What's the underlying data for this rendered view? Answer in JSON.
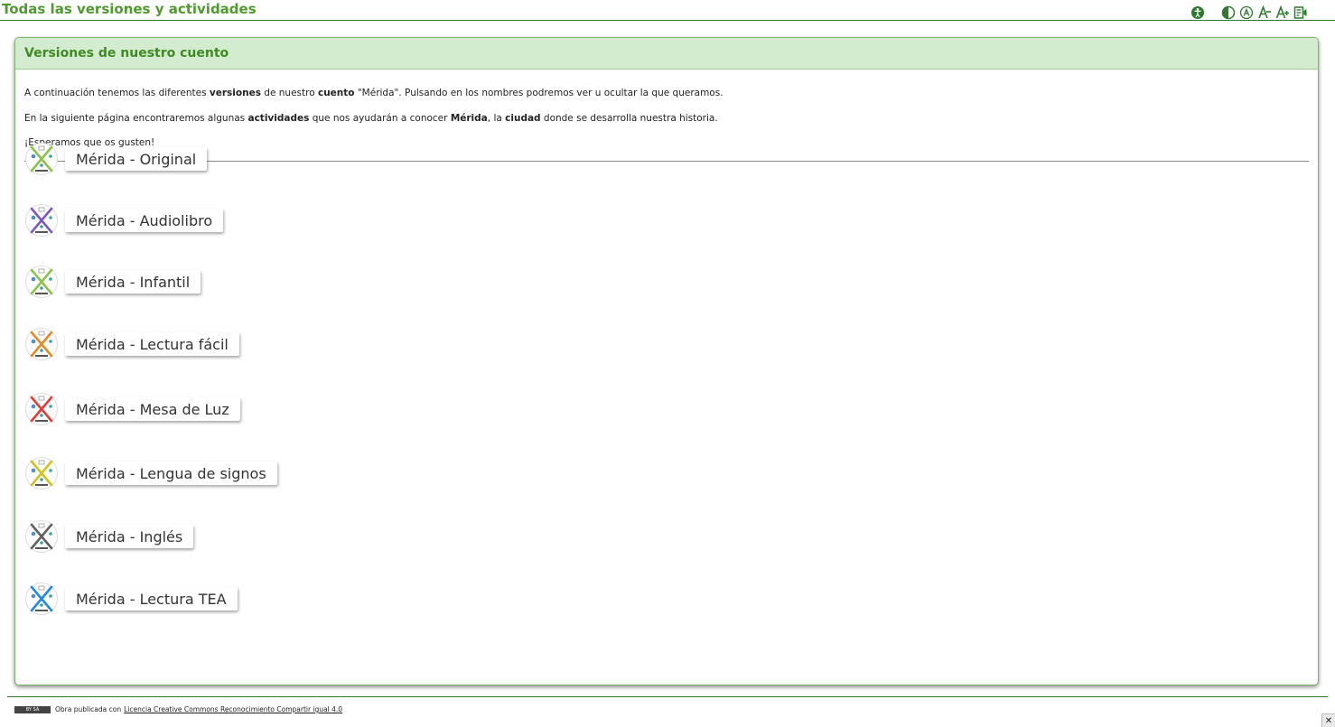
{
  "header": {
    "title": "Todas las versiones y actividades",
    "toolbar": [
      {
        "icon": "accessibility-icon"
      },
      {
        "icon": "contrast-icon"
      },
      {
        "icon": "font-type-icon"
      },
      {
        "icon": "font-decrease-icon"
      },
      {
        "icon": "font-increase-icon"
      },
      {
        "icon": "read-aloud-icon"
      }
    ]
  },
  "panel": {
    "title": "Versiones de nuestro cuento",
    "intro": {
      "p1": [
        "A continuación tenemos las diferentes ",
        "versiones",
        " de nuestro ",
        "cuento",
        " \"Mérida\". Pulsando en los nombres podremos ver u ocultar la que queramos."
      ],
      "p2": [
        "En la siguiente página encontraremos algunas ",
        "actividades",
        " que nos ayudarán a conocer ",
        "Mérida",
        ", la ",
        "ciudad",
        " donde se desarrolla nuestra historia."
      ],
      "p3": "¡Esperamos que os gusten!"
    },
    "versions": [
      {
        "label": "Mérida - Original",
        "color": "#8bc34a"
      },
      {
        "label": "Mérida - Audiolibro",
        "color": "#7e57c2"
      },
      {
        "label": "Mérida - Infantil",
        "color": "#8bc34a"
      },
      {
        "label": "Mérida - Lectura fácil",
        "color": "#e68a1f"
      },
      {
        "label": "Mérida - Mesa de Luz",
        "color": "#e53935"
      },
      {
        "label": "Mérida - Lengua de signos",
        "color": "#d4c21a"
      },
      {
        "label": "Mérida - Inglés",
        "color": "#616161"
      },
      {
        "label": "Mérida - Lectura TEA",
        "color": "#1e88e5"
      }
    ]
  },
  "footer": {
    "badge": "BY SA",
    "text": "Obra publicada con",
    "link": "Licencia Creative Commons Reconocimiento Compartir igual 4.0"
  },
  "colors": {
    "accent_green": "#4f9a2f",
    "panel_head_bg": "#d3ecd0"
  }
}
